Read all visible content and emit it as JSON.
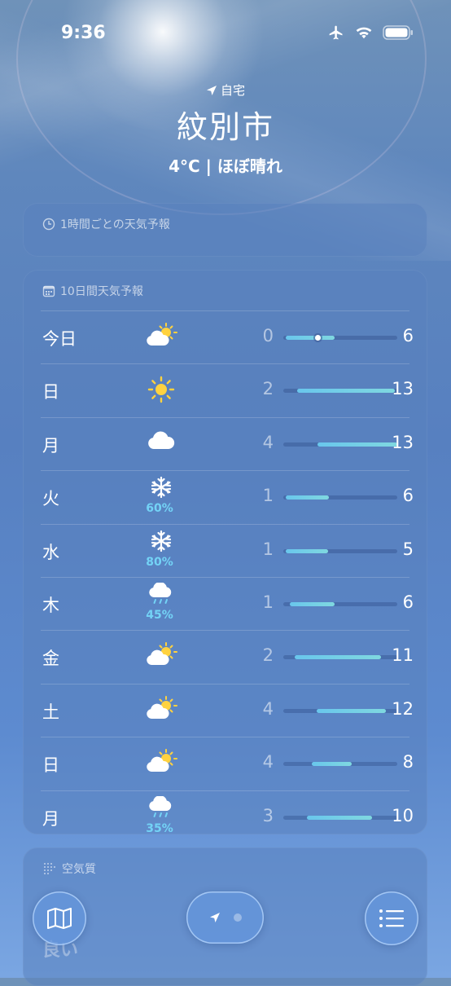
{
  "status_bar": {
    "time": "9:36"
  },
  "header": {
    "location_label": "自宅",
    "city": "紋別市",
    "condition": "4°C | ほぼ晴れ"
  },
  "hourly_card": {
    "title": "1時間ごとの天気予報"
  },
  "daily_card": {
    "title": "10日間天気予報",
    "days": [
      {
        "day": "今日",
        "icon": "partly-sunny-icon",
        "precip": "",
        "low": "0",
        "high": "6",
        "bar_start": 0.02,
        "bar_end": 0.45,
        "current_marker": 0.3
      },
      {
        "day": "日",
        "icon": "sun-icon",
        "precip": "",
        "low": "2",
        "high": "13",
        "bar_start": 0.12,
        "bar_end": 0.98
      },
      {
        "day": "月",
        "icon": "cloud-icon",
        "precip": "",
        "low": "4",
        "high": "13",
        "bar_start": 0.3,
        "bar_end": 1.0
      },
      {
        "day": "火",
        "icon": "snowflake-icon",
        "precip": "60%",
        "low": "1",
        "high": "6",
        "bar_start": 0.02,
        "bar_end": 0.4
      },
      {
        "day": "水",
        "icon": "snowflake-icon",
        "precip": "80%",
        "low": "1",
        "high": "5",
        "bar_start": 0.02,
        "bar_end": 0.39
      },
      {
        "day": "木",
        "icon": "rain-cloud-icon",
        "precip": "45%",
        "low": "1",
        "high": "6",
        "bar_start": 0.06,
        "bar_end": 0.45
      },
      {
        "day": "金",
        "icon": "partly-sunny-icon",
        "precip": "",
        "low": "2",
        "high": "11",
        "bar_start": 0.1,
        "bar_end": 0.86
      },
      {
        "day": "土",
        "icon": "partly-sunny-icon",
        "precip": "",
        "low": "4",
        "high": "12",
        "bar_start": 0.29,
        "bar_end": 0.9
      },
      {
        "day": "日",
        "icon": "partly-sunny-icon",
        "precip": "",
        "low": "4",
        "high": "8",
        "bar_start": 0.25,
        "bar_end": 0.6
      },
      {
        "day": "月",
        "icon": "rain-cloud-icon",
        "precip": "35%",
        "low": "3",
        "high": "10",
        "bar_start": 0.21,
        "bar_end": 0.78
      }
    ]
  },
  "air_quality_card": {
    "title": "空気質",
    "value": "良い"
  },
  "colors": {
    "bar": "#69c6ec",
    "precip": "#73d3f6",
    "sun": "#ffd23f"
  }
}
